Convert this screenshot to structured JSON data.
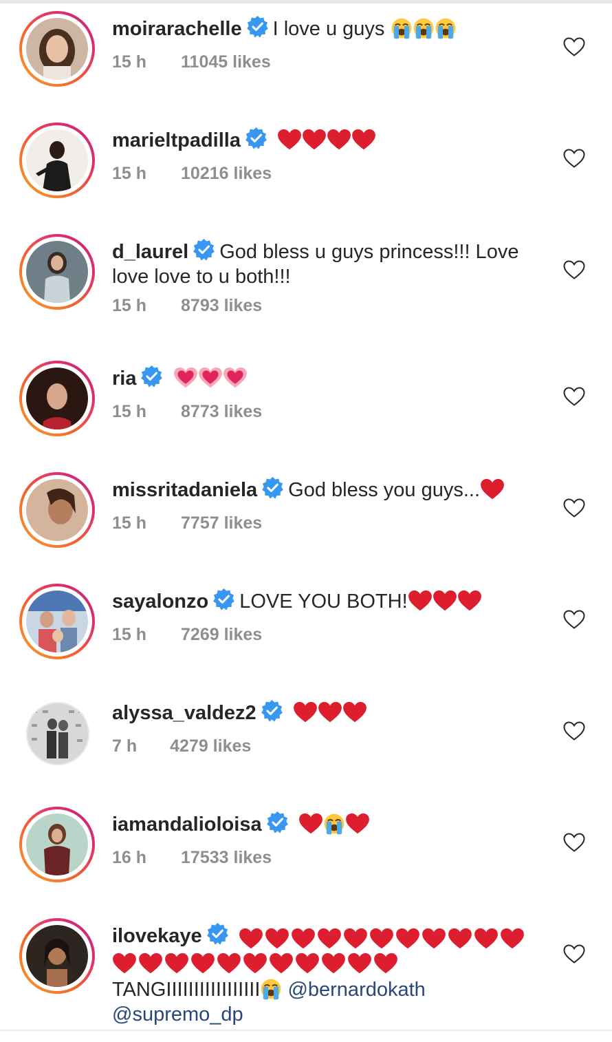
{
  "comments": [
    {
      "username": "moirarachelle",
      "text": "I love u guys",
      "emojis": [
        "loudly-crying-face",
        "loudly-crying-face",
        "loudly-crying-face"
      ],
      "time": "15 h",
      "likes": "11045 likes"
    },
    {
      "username": "marieltpadilla",
      "text": "",
      "emojis": [
        "red-heart",
        "red-heart",
        "red-heart",
        "red-heart"
      ],
      "time": "15 h",
      "likes": "10216 likes"
    },
    {
      "username": "d_laurel",
      "text": "God bless u guys princess!!! Love",
      "text_cont": "love love to u both!!!",
      "time": "15 h",
      "likes": "8793 likes"
    },
    {
      "username": "ria",
      "text": "",
      "emojis": [
        "beating-heart",
        "beating-heart",
        "beating-heart"
      ],
      "time": "15 h",
      "likes": "8773 likes"
    },
    {
      "username": "missritadaniela",
      "text": "God bless you guys...",
      "emojis": [
        "red-heart"
      ],
      "time": "15 h",
      "likes": "7757 likes"
    },
    {
      "username": "sayalonzo",
      "text": "LOVE YOU BOTH!",
      "emojis": [
        "red-heart",
        "red-heart",
        "red-heart"
      ],
      "time": "15 h",
      "likes": "7269 likes"
    },
    {
      "username": "alyssa_valdez2",
      "text": "",
      "emojis": [
        "red-heart",
        "red-heart",
        "red-heart"
      ],
      "time": "7 h",
      "likes": "4279 likes"
    },
    {
      "username": "iamandalioloisa",
      "text": "",
      "emojis": [
        "red-heart",
        "loudly-crying-face",
        "red-heart"
      ],
      "time": "16 h",
      "likes": "17533 likes"
    },
    {
      "username": "ilovekaye",
      "text": "",
      "emojis_line1_count": 11,
      "emojis_line2_count": 11,
      "text_line3": "TANGIIIIIIIIIIIIIIIII",
      "mention1": "@bernardokath",
      "mention2": "@supremo_dp",
      "time": "",
      "likes": ""
    }
  ],
  "colors": {
    "verified_blue": "#3897f0",
    "heart_red": "#dd1e2f",
    "meta_gray": "#8e8e8e",
    "mention_blue": "#27477a"
  },
  "icons": {
    "verified": "verified-badge-icon",
    "like": "heart-outline-icon"
  }
}
